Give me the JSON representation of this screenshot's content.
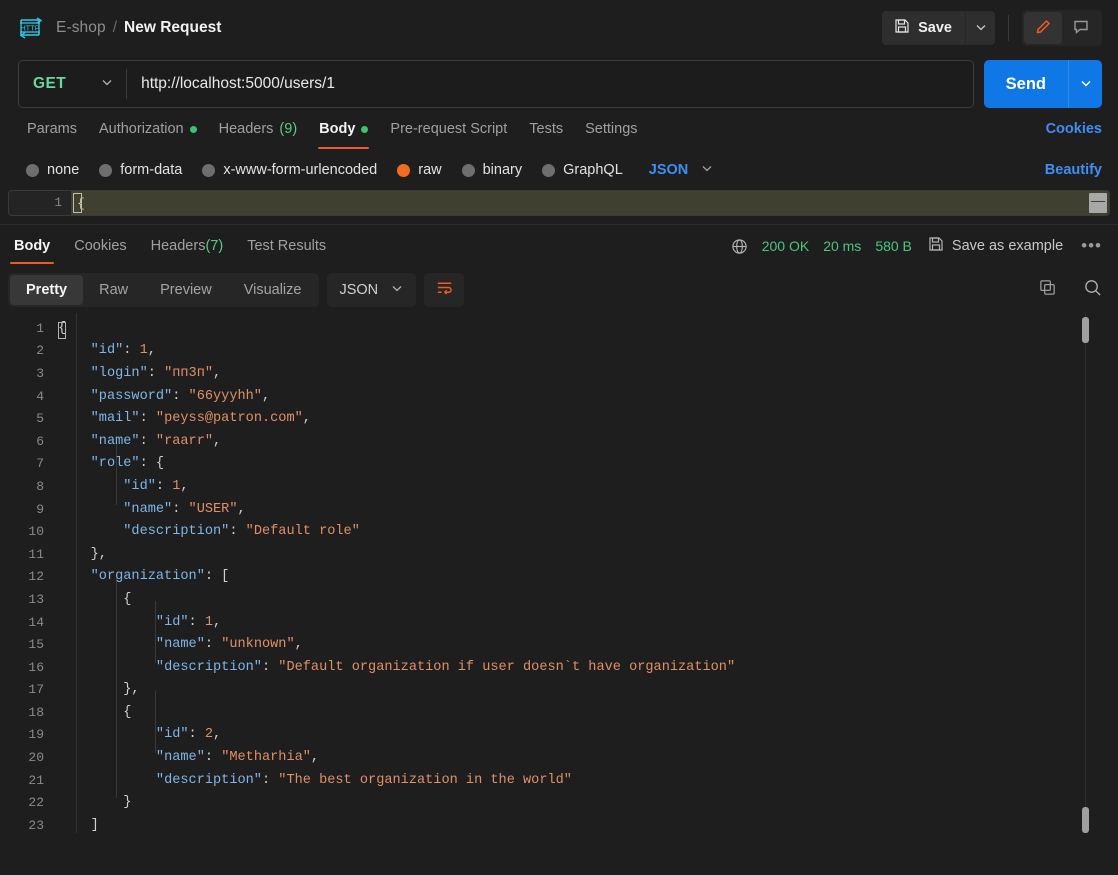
{
  "header": {
    "app_icon": "http-icon",
    "breadcrumb_parent": "E-shop",
    "breadcrumb_separator": "/",
    "breadcrumb_current": "New Request",
    "save_label": "Save",
    "save_icon": "floppy-disk-icon",
    "save_caret_icon": "chevron-down-icon",
    "edit_icon": "pencil-icon",
    "comment_icon": "comment-icon",
    "accent_orange": "#ef5b25"
  },
  "request": {
    "method": "GET",
    "method_color": "#6bd6a0",
    "method_caret_icon": "chevron-down-icon",
    "url": "http://localhost:5000/users/1",
    "url_placeholder": "Enter request URL",
    "send_label": "Send",
    "send_caret_icon": "chevron-down-icon",
    "send_color": "#1078e6"
  },
  "request_tabs": {
    "items": [
      {
        "label": "Params",
        "dot": false,
        "count": "",
        "active": false
      },
      {
        "label": "Authorization",
        "dot": true,
        "count": "",
        "active": false
      },
      {
        "label": "Headers",
        "dot": false,
        "count": "(9)",
        "active": false
      },
      {
        "label": "Body",
        "dot": true,
        "count": "",
        "active": true
      },
      {
        "label": "Pre-request Script",
        "dot": false,
        "count": "",
        "active": false
      },
      {
        "label": "Tests",
        "dot": false,
        "count": "",
        "active": false
      },
      {
        "label": "Settings",
        "dot": false,
        "count": "",
        "active": false
      }
    ],
    "cookies_label": "Cookies"
  },
  "body_type": {
    "options": [
      {
        "label": "none",
        "selected": false
      },
      {
        "label": "form-data",
        "selected": false
      },
      {
        "label": "x-www-form-urlencoded",
        "selected": false
      },
      {
        "label": "raw",
        "selected": true
      },
      {
        "label": "binary",
        "selected": false
      },
      {
        "label": "GraphQL",
        "selected": false
      }
    ],
    "format_label": "JSON",
    "format_caret_icon": "chevron-down-icon",
    "beautify_label": "Beautify",
    "selected_color": "#f26b21"
  },
  "request_editor": {
    "line_number": "1",
    "line_text": "{",
    "scrollbar_name": "horizontal-scrollbar"
  },
  "response_tabs": {
    "items": [
      {
        "label": "Body",
        "count": "",
        "active": true
      },
      {
        "label": "Cookies",
        "count": "",
        "active": false
      },
      {
        "label": "Headers",
        "count": "(7)",
        "active": false
      },
      {
        "label": "Test Results",
        "count": "",
        "active": false
      }
    ],
    "status_icon": "globe-icon",
    "status": "200 OK",
    "time": "20 ms",
    "size": "580 B",
    "save_example_icon": "floppy-disk-icon",
    "save_example_label": "Save as example",
    "more_label": "•••",
    "status_color": "#4cc57f"
  },
  "view_toolbar": {
    "modes": [
      {
        "label": "Pretty",
        "active": true
      },
      {
        "label": "Raw",
        "active": false
      },
      {
        "label": "Preview",
        "active": false
      },
      {
        "label": "Visualize",
        "active": false
      }
    ],
    "format_label": "JSON",
    "format_caret_icon": "chevron-down-icon",
    "wrap_icon": "wrap-text-icon",
    "copy_icon": "copy-icon",
    "search_icon": "search-icon"
  },
  "response_body": {
    "language": "json",
    "lines": [
      {
        "n": "1",
        "tokens": [
          {
            "t": "p",
            "v": "{"
          }
        ]
      },
      {
        "n": "2",
        "tokens": [
          {
            "t": "p",
            "v": "    "
          },
          {
            "t": "k",
            "v": "\"id\""
          },
          {
            "t": "p",
            "v": ": "
          },
          {
            "t": "n",
            "v": "1"
          },
          {
            "t": "p",
            "v": ","
          }
        ]
      },
      {
        "n": "3",
        "tokens": [
          {
            "t": "p",
            "v": "    "
          },
          {
            "t": "k",
            "v": "\"login\""
          },
          {
            "t": "p",
            "v": ": "
          },
          {
            "t": "s",
            "v": "\"пп3п\""
          },
          {
            "t": "p",
            "v": ","
          }
        ]
      },
      {
        "n": "4",
        "tokens": [
          {
            "t": "p",
            "v": "    "
          },
          {
            "t": "k",
            "v": "\"password\""
          },
          {
            "t": "p",
            "v": ": "
          },
          {
            "t": "s",
            "v": "\"66yyyhh\""
          },
          {
            "t": "p",
            "v": ","
          }
        ]
      },
      {
        "n": "5",
        "tokens": [
          {
            "t": "p",
            "v": "    "
          },
          {
            "t": "k",
            "v": "\"mail\""
          },
          {
            "t": "p",
            "v": ": "
          },
          {
            "t": "s",
            "v": "\"peyss@patron.com\""
          },
          {
            "t": "p",
            "v": ","
          }
        ]
      },
      {
        "n": "6",
        "tokens": [
          {
            "t": "p",
            "v": "    "
          },
          {
            "t": "k",
            "v": "\"name\""
          },
          {
            "t": "p",
            "v": ": "
          },
          {
            "t": "s",
            "v": "\"raarr\""
          },
          {
            "t": "p",
            "v": ","
          }
        ]
      },
      {
        "n": "7",
        "tokens": [
          {
            "t": "p",
            "v": "    "
          },
          {
            "t": "k",
            "v": "\"role\""
          },
          {
            "t": "p",
            "v": ": {"
          }
        ]
      },
      {
        "n": "8",
        "tokens": [
          {
            "t": "p",
            "v": "        "
          },
          {
            "t": "k",
            "v": "\"id\""
          },
          {
            "t": "p",
            "v": ": "
          },
          {
            "t": "n",
            "v": "1"
          },
          {
            "t": "p",
            "v": ","
          }
        ]
      },
      {
        "n": "9",
        "tokens": [
          {
            "t": "p",
            "v": "        "
          },
          {
            "t": "k",
            "v": "\"name\""
          },
          {
            "t": "p",
            "v": ": "
          },
          {
            "t": "s",
            "v": "\"USER\""
          },
          {
            "t": "p",
            "v": ","
          }
        ]
      },
      {
        "n": "10",
        "tokens": [
          {
            "t": "p",
            "v": "        "
          },
          {
            "t": "k",
            "v": "\"description\""
          },
          {
            "t": "p",
            "v": ": "
          },
          {
            "t": "s",
            "v": "\"Default role\""
          }
        ]
      },
      {
        "n": "11",
        "tokens": [
          {
            "t": "p",
            "v": "    },"
          }
        ]
      },
      {
        "n": "12",
        "tokens": [
          {
            "t": "p",
            "v": "    "
          },
          {
            "t": "k",
            "v": "\"organization\""
          },
          {
            "t": "p",
            "v": ": ["
          }
        ]
      },
      {
        "n": "13",
        "tokens": [
          {
            "t": "p",
            "v": "        {"
          }
        ]
      },
      {
        "n": "14",
        "tokens": [
          {
            "t": "p",
            "v": "            "
          },
          {
            "t": "k",
            "v": "\"id\""
          },
          {
            "t": "p",
            "v": ": "
          },
          {
            "t": "n",
            "v": "1"
          },
          {
            "t": "p",
            "v": ","
          }
        ]
      },
      {
        "n": "15",
        "tokens": [
          {
            "t": "p",
            "v": "            "
          },
          {
            "t": "k",
            "v": "\"name\""
          },
          {
            "t": "p",
            "v": ": "
          },
          {
            "t": "s",
            "v": "\"unknown\""
          },
          {
            "t": "p",
            "v": ","
          }
        ]
      },
      {
        "n": "16",
        "tokens": [
          {
            "t": "p",
            "v": "            "
          },
          {
            "t": "k",
            "v": "\"description\""
          },
          {
            "t": "p",
            "v": ": "
          },
          {
            "t": "s",
            "v": "\"Default organization if user doesn`t have organization\""
          }
        ]
      },
      {
        "n": "17",
        "tokens": [
          {
            "t": "p",
            "v": "        },"
          }
        ]
      },
      {
        "n": "18",
        "tokens": [
          {
            "t": "p",
            "v": "        {"
          }
        ]
      },
      {
        "n": "19",
        "tokens": [
          {
            "t": "p",
            "v": "            "
          },
          {
            "t": "k",
            "v": "\"id\""
          },
          {
            "t": "p",
            "v": ": "
          },
          {
            "t": "n",
            "v": "2"
          },
          {
            "t": "p",
            "v": ","
          }
        ]
      },
      {
        "n": "20",
        "tokens": [
          {
            "t": "p",
            "v": "            "
          },
          {
            "t": "k",
            "v": "\"name\""
          },
          {
            "t": "p",
            "v": ": "
          },
          {
            "t": "s",
            "v": "\"Metharhia\""
          },
          {
            "t": "p",
            "v": ","
          }
        ]
      },
      {
        "n": "21",
        "tokens": [
          {
            "t": "p",
            "v": "            "
          },
          {
            "t": "k",
            "v": "\"description\""
          },
          {
            "t": "p",
            "v": ": "
          },
          {
            "t": "s",
            "v": "\"The best organization in the world\""
          }
        ]
      },
      {
        "n": "22",
        "tokens": [
          {
            "t": "p",
            "v": "        }"
          }
        ]
      },
      {
        "n": "23",
        "tokens": [
          {
            "t": "p",
            "v": "    ]"
          }
        ]
      }
    ]
  }
}
